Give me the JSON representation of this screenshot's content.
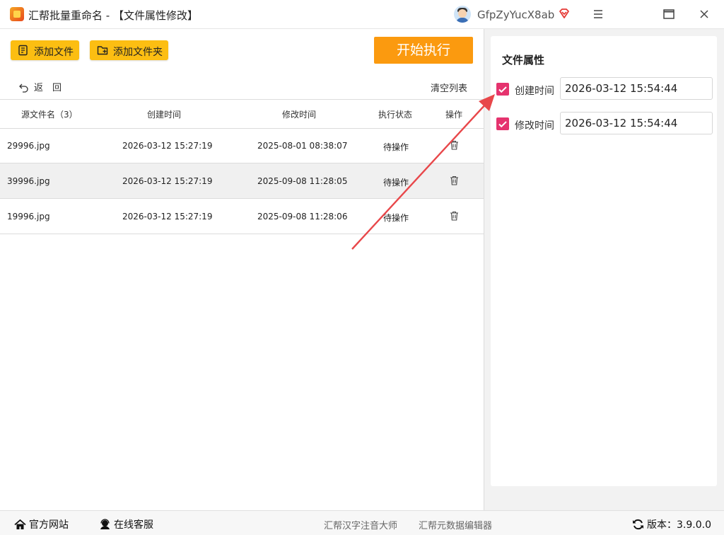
{
  "titlebar": {
    "title": "汇帮批量重命名 - 【文件属性修改】",
    "username": "GfpZyYucX8ab",
    "logo_icon": "app-logo",
    "vip_icon": "diamond-icon",
    "menu_icon": "menu-icon",
    "maximize_icon": "maximize-icon",
    "close_icon": "close-icon"
  },
  "toolbar": {
    "add_file_label": "添加文件",
    "add_folder_label": "添加文件夹",
    "start_label": "开始执行",
    "back_label": "返　回",
    "clear_label": "清空列表",
    "accent": "#fcbe12",
    "start_color": "#fb9a0f"
  },
  "table": {
    "headers": [
      "源文件名（3）",
      "创建时间",
      "修改时间",
      "执行状态",
      "操作"
    ],
    "rows": [
      {
        "name": "29996.jpg",
        "created": "2026-03-12 15:27:19",
        "modified": "2025-08-01 08:38:07",
        "status": "待操作"
      },
      {
        "name": "39996.jpg",
        "created": "2026-03-12 15:27:19",
        "modified": "2025-09-08 11:28:05",
        "status": "待操作"
      },
      {
        "name": "19996.jpg",
        "created": "2026-03-12 15:27:19",
        "modified": "2025-09-08 11:28:06",
        "status": "待操作"
      }
    ],
    "selected_row": 1,
    "delete_icon": "trash-icon"
  },
  "panel": {
    "title": "文件属性",
    "create_label": "创建时间",
    "create_value": "2026-03-12 15:54:44",
    "create_checked": true,
    "modify_label": "修改时间",
    "modify_value": "2026-03-12 15:54:44",
    "modify_checked": true,
    "check_color": "#e5336e",
    "arrow_color": "#e8474a"
  },
  "footer": {
    "website_label": "官方网站",
    "service_label": "在线客服",
    "link1": "汇帮汉字注音大师",
    "link2": "汇帮元数据编辑器",
    "version_label": "版本：3.9.0.0"
  }
}
